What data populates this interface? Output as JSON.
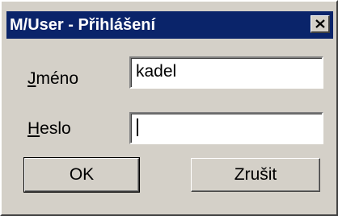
{
  "window": {
    "title": "M/User - Přihlášení"
  },
  "form": {
    "username": {
      "label_accel": "J",
      "label_rest": "méno",
      "value": "kadel"
    },
    "password": {
      "label_accel": "H",
      "label_rest": "eslo",
      "value": ""
    }
  },
  "buttons": {
    "ok_label": "OK",
    "cancel_label": "Zrušit"
  },
  "icons": {
    "close": "close-icon"
  },
  "colors": {
    "titlebar_background": "#0a246a",
    "dialog_background": "#d4d0c8",
    "field_background": "#ffffff"
  }
}
